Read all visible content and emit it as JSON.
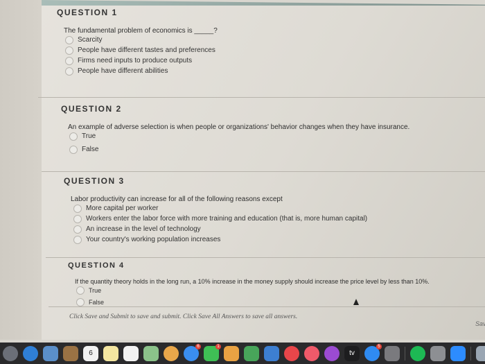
{
  "questions": [
    {
      "title": "QUESTION 1",
      "text": "The fundamental problem of economics is _____?",
      "options": [
        "Scarcity",
        "People have different tastes and preferences",
        "Firms need inputs to produce outputs",
        "People have different abilities"
      ]
    },
    {
      "title": "QUESTION 2",
      "text": "An example of adverse selection is when people or organizations' behavior changes when they have insurance.",
      "options": [
        "True",
        "False"
      ]
    },
    {
      "title": "QUESTION 3",
      "text": "Labor productivity can increase for all of the following reasons except",
      "options": [
        "More capital per worker",
        "Workers enter the labor force with more training and education (that is, more human capital)",
        "An increase in the level of technology",
        "Your country's working population increases"
      ]
    },
    {
      "title": "QUESTION 4",
      "text": "If the quantity theory holds in the long run, a 10% increase in the money supply should increase the price level by less than 10%.",
      "options": [
        "True",
        "False"
      ]
    }
  ],
  "footer": {
    "instructions": "Click Save and Submit to save and submit. Click Save All Answers to save all answers.",
    "save_label": "Sav"
  },
  "dock": {
    "items": [
      {
        "name": "launchpad-icon",
        "color": "#6b6f78",
        "round": true
      },
      {
        "name": "safari-icon",
        "color": "#2f7fd6",
        "round": true
      },
      {
        "name": "preview-icon",
        "color": "#5b8fc9"
      },
      {
        "name": "notes-brown-icon",
        "color": "#9a7244"
      },
      {
        "name": "calendar-icon",
        "color": "#f2f2f2",
        "label": "6"
      },
      {
        "name": "notes-icon",
        "color": "#f4e6a0"
      },
      {
        "name": "reminders-icon",
        "color": "#f2f2f2"
      },
      {
        "name": "maps-icon",
        "color": "#8bc28a"
      },
      {
        "name": "photos-icon",
        "color": "#e9a74a",
        "round": true
      },
      {
        "name": "messages-icon",
        "color": "#3a8ef0",
        "round": true,
        "badge": "6"
      },
      {
        "name": "facetime-icon",
        "color": "#3fbf55",
        "badge": "1"
      },
      {
        "name": "pages-icon",
        "color": "#e9a243"
      },
      {
        "name": "numbers-icon",
        "color": "#48a55a"
      },
      {
        "name": "keynote-icon",
        "color": "#3d7fd1"
      },
      {
        "name": "news-icon",
        "color": "#e9464a",
        "round": true
      },
      {
        "name": "music-icon",
        "color": "#f05a6a",
        "round": true
      },
      {
        "name": "podcasts-icon",
        "color": "#9b4bd2",
        "round": true
      },
      {
        "name": "apple-tv-icon",
        "color": "#1d1d1f",
        "label": "tv"
      },
      {
        "name": "app-store-icon",
        "color": "#2f8bf2",
        "round": true,
        "badge": "5"
      },
      {
        "name": "system-preferences-icon",
        "color": "#7a7a7e"
      },
      {
        "name": "spotify-icon",
        "color": "#1db954",
        "round": true
      },
      {
        "name": "downloads-icon",
        "color": "#8d8f93"
      },
      {
        "name": "zoom-icon",
        "color": "#2d8cff"
      },
      {
        "name": "finder-window-icon",
        "color": "#9aa6b3"
      }
    ]
  }
}
